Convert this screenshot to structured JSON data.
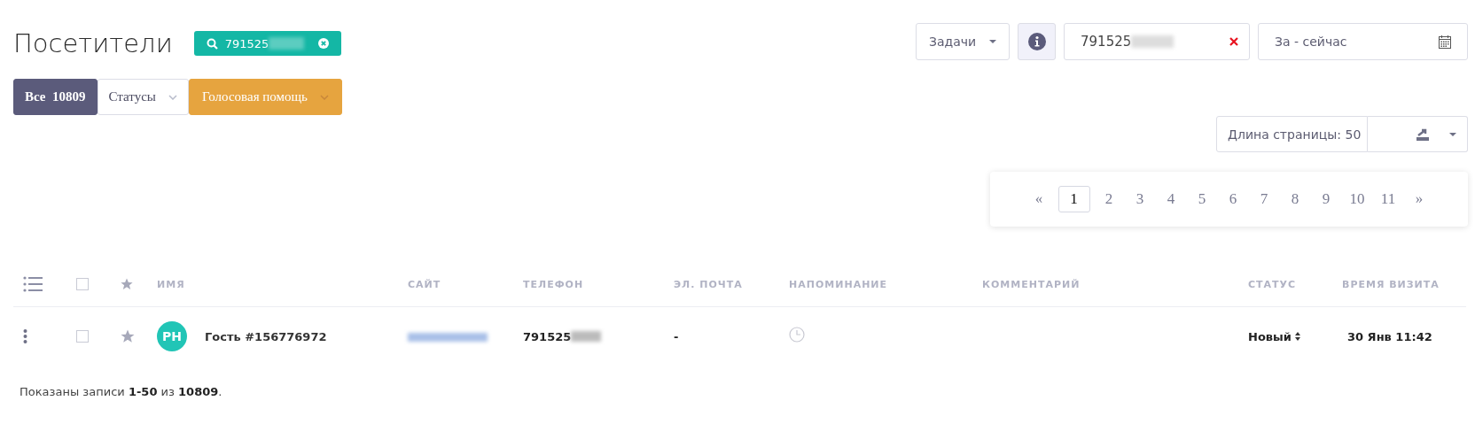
{
  "title": "Посетители",
  "search_chip": {
    "value": "791525"
  },
  "toolbar": {
    "tasks_label": "Задачи",
    "search_value": "791525",
    "date_label": "За - сейчас"
  },
  "filters": [
    {
      "kind": "count",
      "label": "Все",
      "count": "10809"
    },
    {
      "kind": "dropdown",
      "label": "Статусы"
    },
    {
      "kind": "accent",
      "label": "Голосовая помощь"
    }
  ],
  "page_length": {
    "label": "Длина страницы: 50"
  },
  "pagination": {
    "prev": "«",
    "next": "»",
    "pages": [
      {
        "label": "1",
        "selected": true
      },
      {
        "label": "2",
        "selected": false
      },
      {
        "label": "3",
        "selected": false
      },
      {
        "label": "4",
        "selected": false
      },
      {
        "label": "5",
        "selected": false
      },
      {
        "label": "6",
        "selected": false
      },
      {
        "label": "7",
        "selected": false
      },
      {
        "label": "8",
        "selected": false
      },
      {
        "label": "9",
        "selected": false
      },
      {
        "label": "10",
        "selected": false
      },
      {
        "label": "11",
        "selected": false
      }
    ]
  },
  "table": {
    "all_checked": false,
    "columns": [
      "ИМЯ",
      "САЙТ",
      "ТЕЛЕФОН",
      "ЭЛ. ПОЧТА",
      "НАПОМИНАНИЕ",
      "КОММЕНТАРИЙ",
      "СТАТУС",
      "ВРЕМЯ ВИЗИТА"
    ],
    "rows": [
      {
        "checked": false,
        "starred": false,
        "initials": "PH",
        "name": "Гость #156776972",
        "phone": "791525",
        "email": "-",
        "status": "Новый",
        "time": "30 Янв 11:42"
      }
    ]
  },
  "footer": "Показаны записи **1-50** из **10809**."
}
